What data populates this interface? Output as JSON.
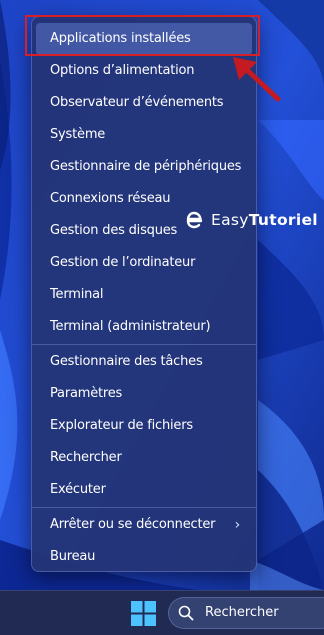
{
  "context_menu": {
    "group1": [
      {
        "label": "Applications installées"
      },
      {
        "label": "Options d’alimentation"
      },
      {
        "label": "Observateur d’événements"
      },
      {
        "label": "Système"
      },
      {
        "label": "Gestionnaire de périphériques"
      },
      {
        "label": "Connexions réseau"
      },
      {
        "label": "Gestion des disques"
      },
      {
        "label": "Gestion de l’ordinateur"
      },
      {
        "label": "Terminal"
      },
      {
        "label": "Terminal (administrateur)"
      }
    ],
    "group2": [
      {
        "label": "Gestionnaire des tâches"
      },
      {
        "label": "Paramètres"
      },
      {
        "label": "Explorateur de fichiers"
      },
      {
        "label": "Rechercher"
      },
      {
        "label": "Exécuter"
      }
    ],
    "group3": [
      {
        "label": "Arrêter ou se déconnecter",
        "submenu_icon": "chevron-right-icon"
      },
      {
        "label": "Bureau"
      }
    ]
  },
  "watermark": {
    "brand_plain": "Easy",
    "brand_bold": "Tutoriel",
    "logo_icon": "easytutoriel-logo-icon"
  },
  "taskbar": {
    "start_icon": "windows-start-icon",
    "search": {
      "label": "Rechercher",
      "icon": "search-icon"
    }
  },
  "colors": {
    "highlight_box": "#d61f26",
    "arrow": "#c41a22",
    "menu_bg": "#243476",
    "wallpaper": "#1a3fb8",
    "taskbar_bg": "#202a52",
    "start_logo": "#4cc2ff"
  }
}
